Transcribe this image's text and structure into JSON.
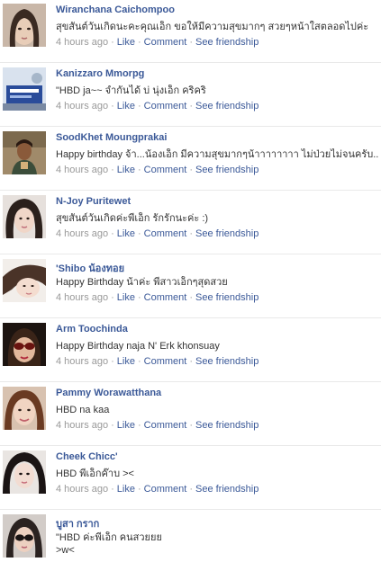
{
  "posts": [
    {
      "author": "Wiranchana Caichompoo",
      "text": "สุขสันต์วันเกิดนะคะคุณเอ็ก ขอให้มีความสุขมากๆ สวยๆหน้าใสตลอดไปค่ะ",
      "time": "4 hours ago",
      "like": "Like",
      "comment": "Comment",
      "see_friendship": "See friendship"
    },
    {
      "author": "Kanizzaro Mmorpg",
      "text": "\"HBD ja~~ จำกันได้ บ่ นุ่งเอ็ก คริคริ",
      "time": "4 hours ago",
      "like": "Like",
      "comment": "Comment",
      "see_friendship": "See friendship"
    },
    {
      "author": "SoodKhet Moungprakai",
      "text": "Happy birthday จ้า...น้องเอ็ก มีความสุขมากๆน้าาาาาาาา ไม่ป่วยไม่จนครับ....",
      "time": "4 hours ago",
      "like": "Like",
      "comment": "Comment",
      "see_friendship": "See friendship"
    },
    {
      "author": "N-Joy Puritewet",
      "text": "สุขสันต์วันเกิดค่ะพี่เอ็ก รักรักนะค่ะ :)",
      "time": "4 hours ago",
      "like": "Like",
      "comment": "Comment",
      "see_friendship": "See friendship"
    },
    {
      "author": "'Shibo น้องทอย",
      "text": "Happy Birthday น้าค่ะ พี่สาวเอ็กๆสุดสวย",
      "time": "4 hours ago",
      "like": "Like",
      "comment": "Comment",
      "see_friendship": "See friendship"
    },
    {
      "author": "Arm Toochinda",
      "text": "Happy Birthday naja N' Erk khonsuay",
      "time": "4 hours ago",
      "like": "Like",
      "comment": "Comment",
      "see_friendship": "See friendship"
    },
    {
      "author": "Pammy Worawatthana",
      "text": "HBD na kaa",
      "time": "4 hours ago",
      "like": "Like",
      "comment": "Comment",
      "see_friendship": "See friendship"
    },
    {
      "author": "Cheek Chicc'",
      "text": "HBD พี่เอ็กค๊าบ ><",
      "time": "4 hours ago",
      "like": "Like",
      "comment": "Comment",
      "see_friendship": "See friendship"
    },
    {
      "author": "บูสา กราก",
      "text": "\"HBD ค่ะพี่เอ็ก คนสวยยย",
      "text2": ">w<",
      "time": "",
      "like": "",
      "comment": "",
      "see_friendship": ""
    }
  ],
  "colors": {
    "link": "#3b5998",
    "meta": "#999999",
    "divider": "#e9e9e9"
  }
}
